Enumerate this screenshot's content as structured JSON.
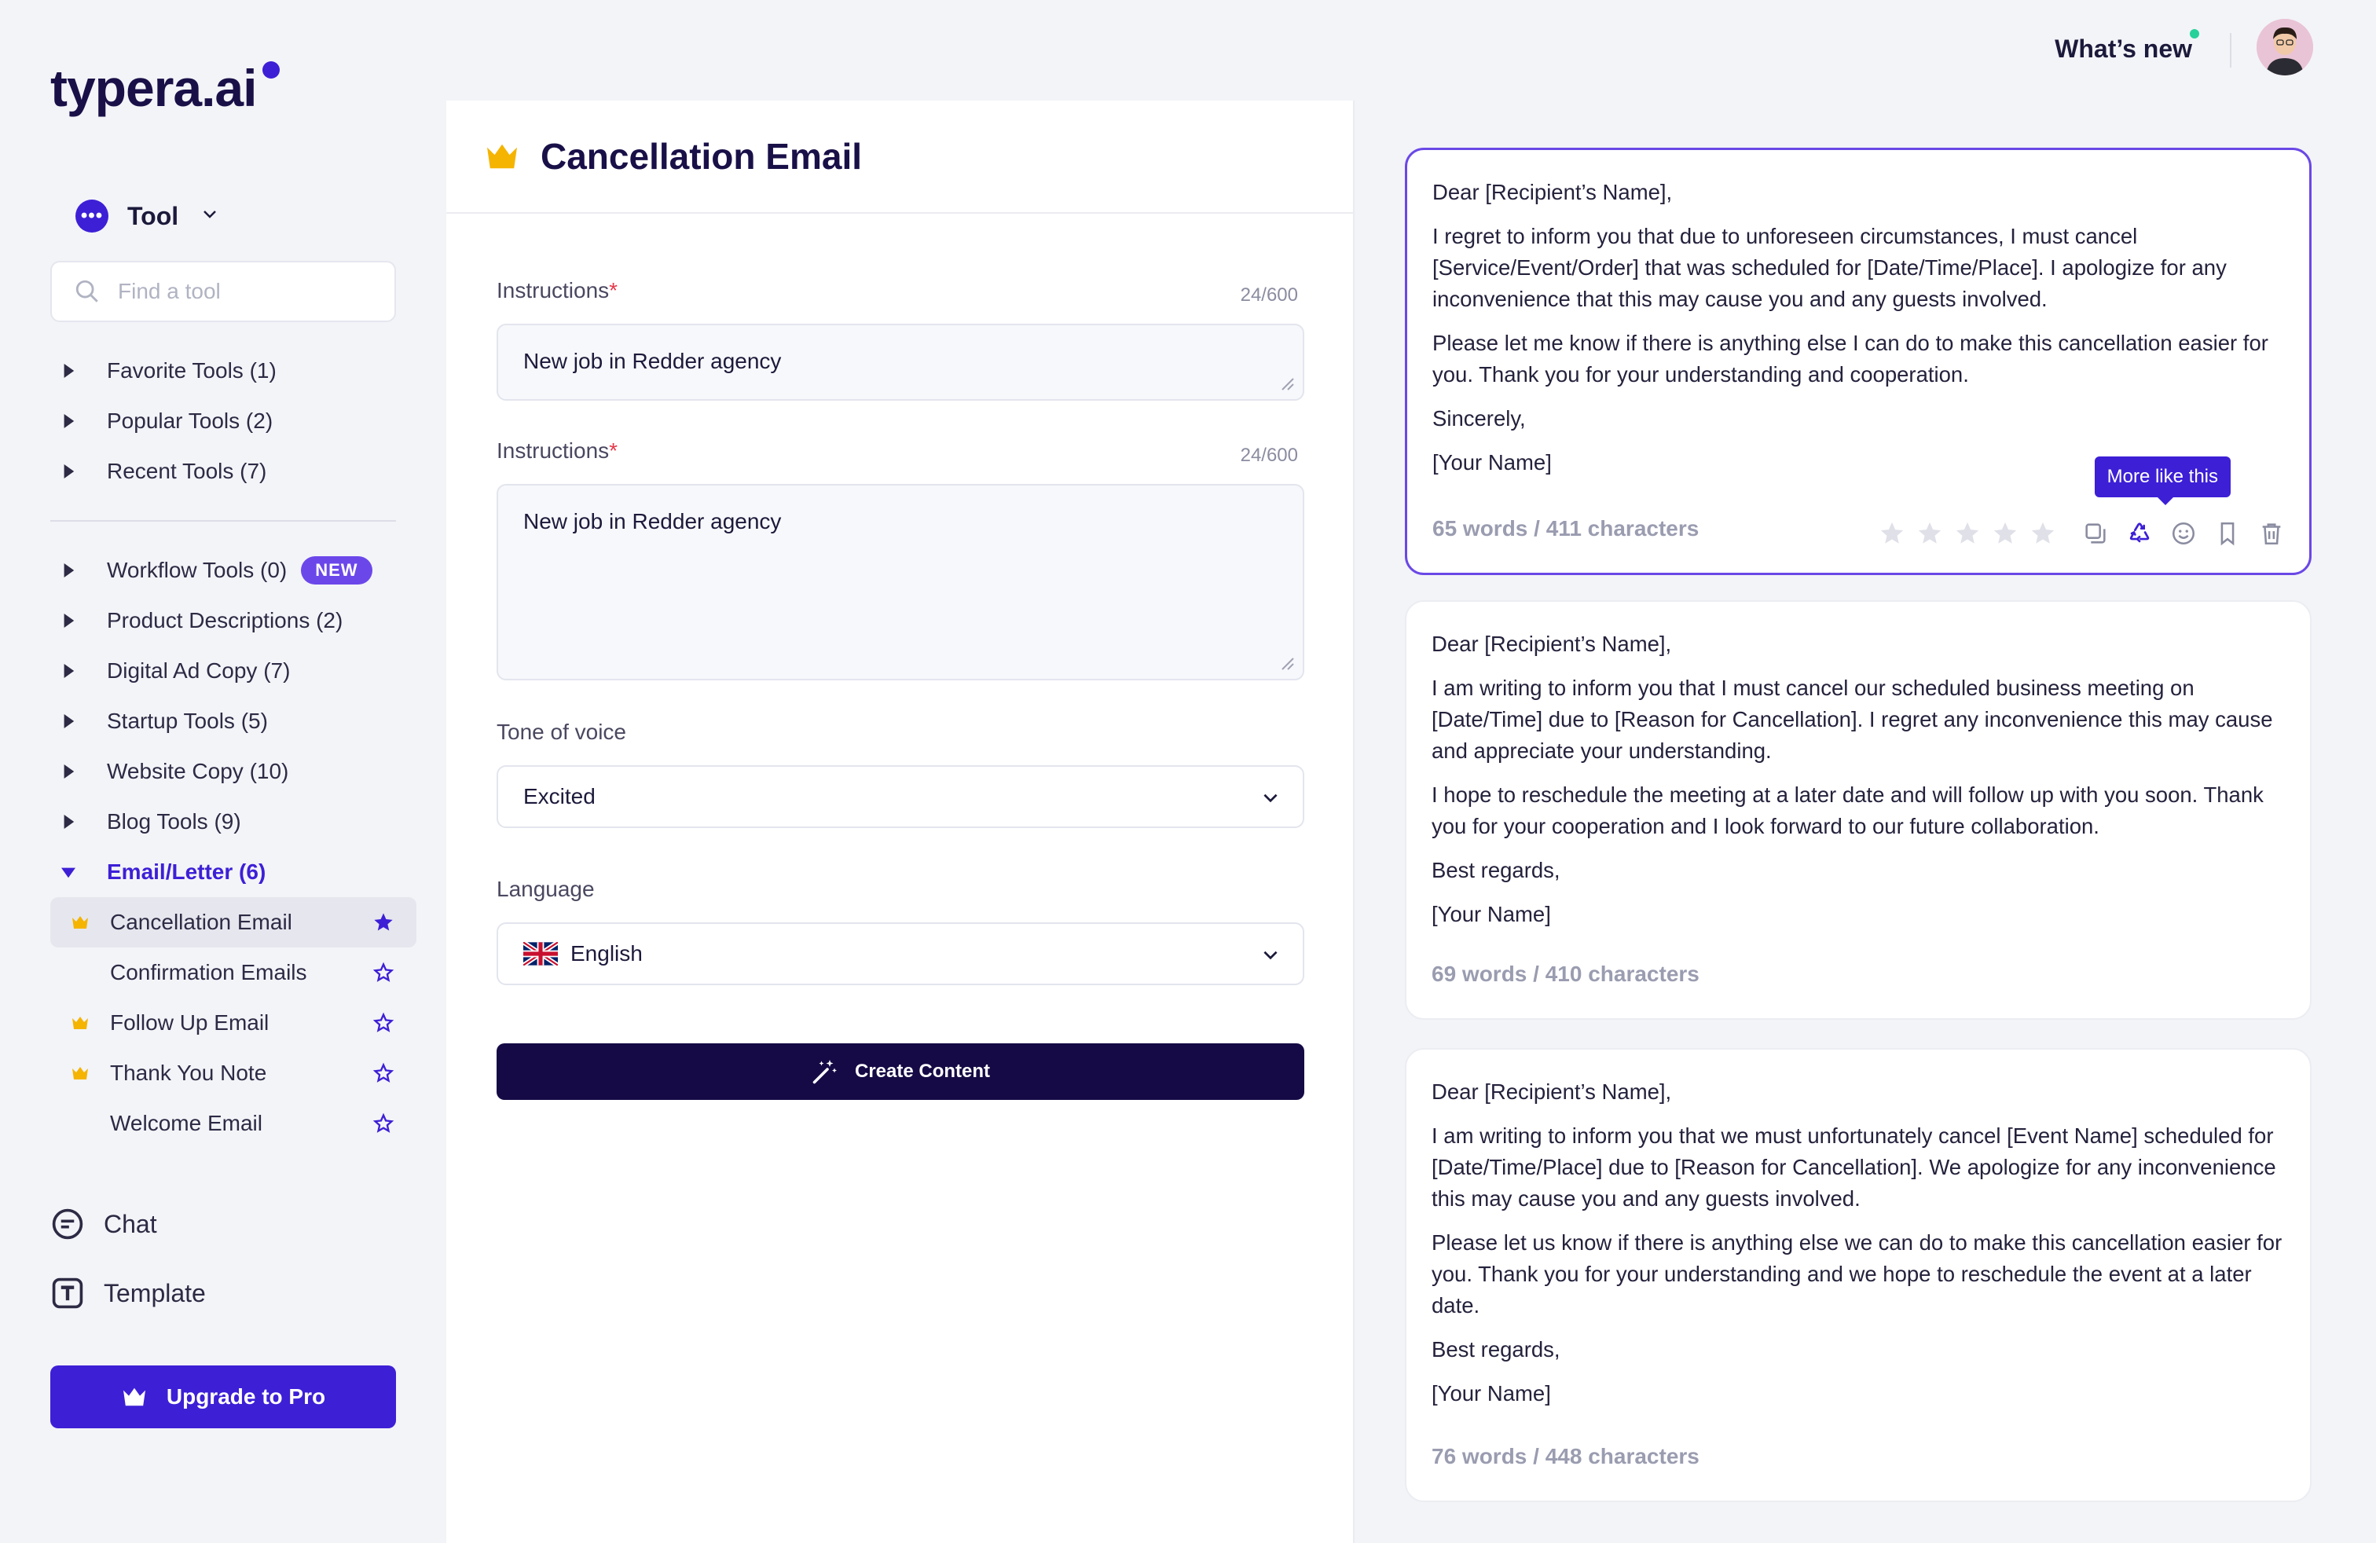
{
  "app": {
    "logo": "typera.ai"
  },
  "header": {
    "whats_new": "What’s new"
  },
  "sidebar": {
    "tool_label": "Tool",
    "search_placeholder": "Find a tool",
    "groups_top": [
      {
        "label": "Favorite Tools (1)"
      },
      {
        "label": "Popular Tools (2)"
      },
      {
        "label": "Recent Tools (7)"
      }
    ],
    "groups": [
      {
        "label": "Workflow Tools (0)",
        "badge": "NEW"
      },
      {
        "label": "Product Descriptions (2)"
      },
      {
        "label": "Digital Ad Copy (7)"
      },
      {
        "label": "Startup Tools (5)"
      },
      {
        "label": "Website Copy (10)"
      },
      {
        "label": "Blog Tools (9)"
      },
      {
        "label": "Email/Letter (6)"
      }
    ],
    "email_items": [
      {
        "label": "Cancellation Email",
        "premium": true,
        "favorite": true
      },
      {
        "label": "Confirmation Emails",
        "premium": false,
        "favorite": false
      },
      {
        "label": "Follow Up Email",
        "premium": true,
        "favorite": false
      },
      {
        "label": "Thank You Note",
        "premium": true,
        "favorite": false
      },
      {
        "label": "Welcome Email",
        "premium": false,
        "favorite": false
      }
    ],
    "chat": "Chat",
    "template": "Template",
    "upgrade": "Upgrade to Pro"
  },
  "form": {
    "title": "Cancellation Email",
    "instr1_label": "Instructions",
    "instr1_counter": "24/600",
    "instr1_value": "New job in Redder agency",
    "instr2_label": "Instructions",
    "instr2_counter": "24/600",
    "instr2_value": "New job in Redder agency",
    "tone_label": "Tone of voice",
    "tone_value": "Excited",
    "language_label": "Language",
    "language_value": "English",
    "create_label": "Create Content"
  },
  "results": [
    {
      "paragraphs": [
        "Dear [Recipient’s Name],",
        "I regret to inform you that due to unforeseen circumstances, I must cancel [Service/Event/Order] that was scheduled for [Date/Time/Place]. I apologize for any inconvenience that this may cause you and any guests involved.",
        "Please let me know if there is anything else I can do to make this cancellation easier for you. Thank you for your understanding and cooperation.",
        "Sincerely,",
        "[Your Name]"
      ],
      "meta": "65 words / 411 characters",
      "tooltip": "More like this"
    },
    {
      "paragraphs": [
        "Dear [Recipient’s Name],",
        "I am writing to inform you that I must cancel our scheduled business meeting on [Date/Time] due to [Reason for Cancellation]. I regret any inconvenience this may cause and appreciate your understanding.",
        "I hope to reschedule the meeting at a later date and will follow up with you soon. Thank you for your cooperation and I look forward to our future collaboration.",
        "Best regards,",
        "[Your Name]"
      ],
      "meta": "69 words / 410 characters"
    },
    {
      "paragraphs": [
        "Dear [Recipient’s Name],",
        "I am writing to inform you that we must unfortunately cancel [Event Name] scheduled for [Date/Time/Place] due to [Reason for Cancellation]. We apologize for any inconvenience this may cause you and any guests involved.",
        "Please let us know if there is anything else we can do to make this cancellation easier for you. Thank you for your understanding and we hope to reschedule the event at a later date.",
        "Best regards,",
        "[Your Name]"
      ],
      "meta": "76 words / 448 characters"
    }
  ],
  "colors": {
    "accent": "#3d1fd6",
    "dark": "#150a45",
    "crown": "#f5b400"
  }
}
